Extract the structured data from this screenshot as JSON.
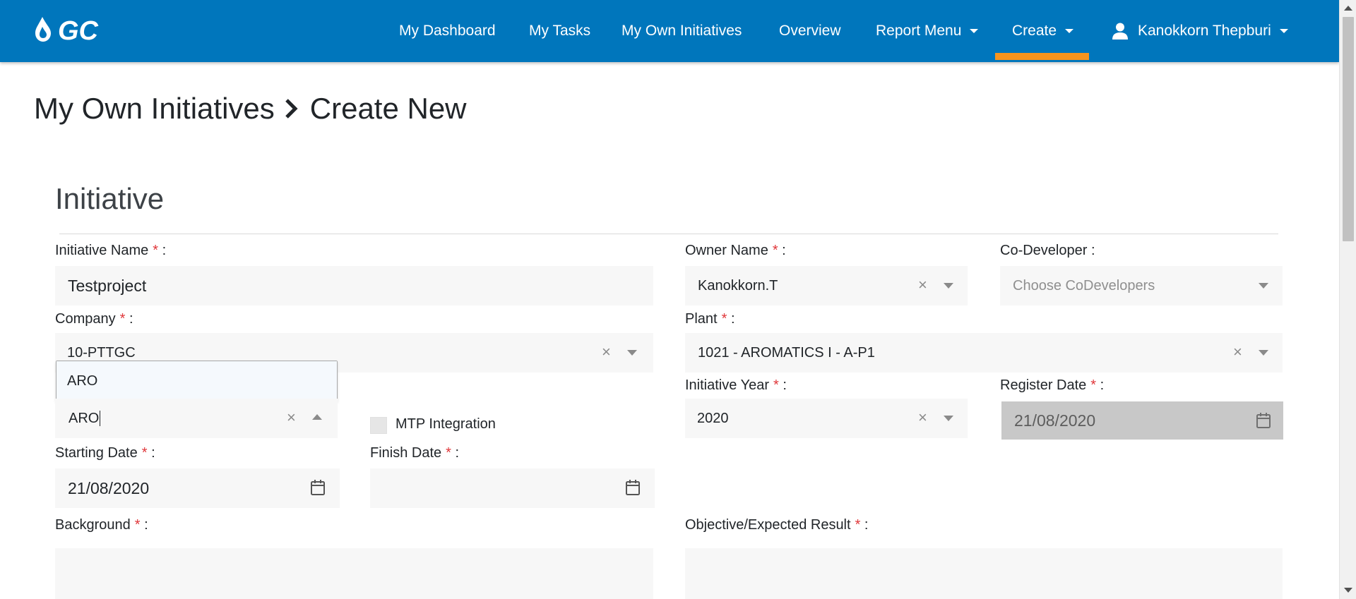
{
  "navbar": {
    "logo_text": "GC",
    "items": [
      {
        "label": "My Dashboard"
      },
      {
        "label": "My Tasks"
      },
      {
        "label": "My Own Initiatives"
      },
      {
        "label": "Overview"
      },
      {
        "label": "Report Menu"
      },
      {
        "label": "Create"
      }
    ],
    "active_item": "Create",
    "user_name": "Kanokkorn Thepburi"
  },
  "breadcrumb": {
    "parent": "My Own Initiatives",
    "current": "Create New"
  },
  "form": {
    "section_title": "Initiative",
    "initiative_name": {
      "label": "Initiative Name",
      "value": "Testproject"
    },
    "owner_name": {
      "label": "Owner Name",
      "value": "Kanokkorn.T"
    },
    "co_developer": {
      "label": "Co-Developer :",
      "placeholder": "Choose CoDevelopers"
    },
    "company": {
      "label": "Company",
      "value": "10-PTTGC"
    },
    "plant": {
      "label": "Plant",
      "value": "1021 - AROMATICS I - A-P1"
    },
    "organization": {
      "search_value": "ARO",
      "dropdown_options": [
        "ARO"
      ]
    },
    "mtp_integration": {
      "label": "MTP Integration",
      "checked": false
    },
    "initiative_year": {
      "label": "Initiative Year",
      "value": "2020"
    },
    "register_date": {
      "label": "Register Date",
      "value": "21/08/2020"
    },
    "starting_date": {
      "label": "Starting Date",
      "value": "21/08/2020"
    },
    "finish_date": {
      "label": "Finish Date",
      "value": ""
    },
    "background": {
      "label": "Background",
      "value": ""
    },
    "objective": {
      "label": "Objective/Expected Result",
      "value": ""
    }
  },
  "colors": {
    "navbar": "#0076bc",
    "active_underline": "#f7941d",
    "required_star": "#e0373a",
    "field_bg": "#f7f7f7",
    "disabled_field_bg": "#c8c8c8"
  }
}
